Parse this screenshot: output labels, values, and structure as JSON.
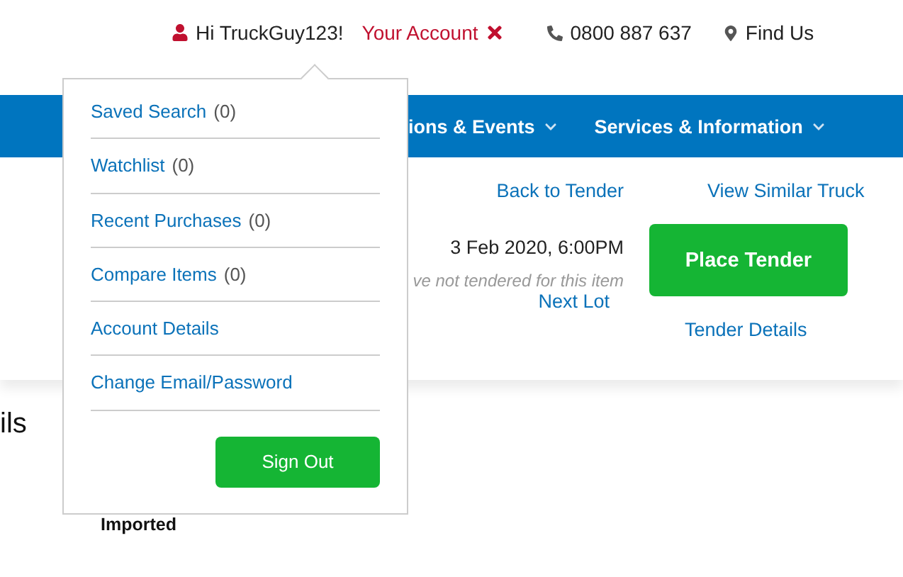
{
  "top_bar": {
    "greeting": "Hi TruckGuy123!",
    "account_link": "Your Account",
    "phone": "0800 887 637",
    "find_us": "Find Us"
  },
  "account_menu": {
    "open": true,
    "items": [
      {
        "label": "Saved Search",
        "count": "(0)"
      },
      {
        "label": "Watchlist",
        "count": "(0)"
      },
      {
        "label": "Recent Purchases",
        "count": "(0)"
      },
      {
        "label": "Compare Items",
        "count": "(0)"
      },
      {
        "label": "Account Details"
      },
      {
        "label": "Change Email/Password"
      }
    ],
    "sign_out": "Sign Out"
  },
  "nav": {
    "items": [
      "ions & Events",
      "Services & Information"
    ]
  },
  "lot": {
    "links": [
      "Back to Tender",
      "View Similar Truck"
    ],
    "closing": "3 Feb 2020, 6:00PM",
    "tender_status": "ve not tendered for this item",
    "next_lot": "Next Lot",
    "place_tender": "Place Tender",
    "tender_details": "Tender Details"
  },
  "details": {
    "heading": "ils",
    "value": "Imported"
  }
}
